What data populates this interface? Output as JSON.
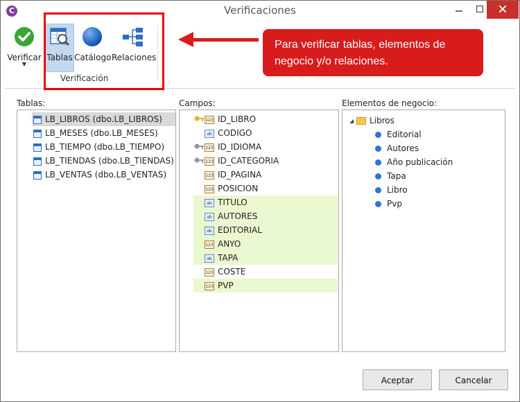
{
  "window": {
    "title": "Verificaciones",
    "app_icon": "C"
  },
  "ribbon": {
    "verificar_label": "Verificar",
    "tablas_label": "Tablas",
    "catalogo_label": "Catálogo",
    "relaciones_label": "Relaciones",
    "group_label": "Verificación",
    "dropdown_glyph": "▼"
  },
  "callout": {
    "text": "Para verificar tablas, elementos de negocio y/o relaciones."
  },
  "tablas": {
    "label": "Tablas:",
    "items": [
      "LB_LIBROS (dbo.LB_LIBROS)",
      "LB_MESES (dbo.LB_MESES)",
      "LB_TIEMPO (dbo.LB_TIEMPO)",
      "LB_TIENDAS (dbo.LB_TIENDAS)",
      "LB_VENTAS (dbo.LB_VENTAS)"
    ],
    "selected_index": 0
  },
  "campos": {
    "label": "Campos:",
    "items": [
      {
        "name": "ID_LIBRO",
        "key": "primary-key-icon",
        "type": "numeric",
        "type_glyph": "123",
        "highlight": false
      },
      {
        "name": "CODIGO",
        "key": "",
        "type": "text",
        "type_glyph": "ab",
        "highlight": false
      },
      {
        "name": "ID_IDIOMA",
        "key": "foreign-key-icon",
        "type": "numeric",
        "type_glyph": "123",
        "highlight": false
      },
      {
        "name": "ID_CATEGORIA",
        "key": "foreign-key-icon",
        "type": "numeric",
        "type_glyph": "123",
        "highlight": false
      },
      {
        "name": "ID_PAGINA",
        "key": "",
        "type": "numeric",
        "type_glyph": "123",
        "highlight": false
      },
      {
        "name": "POSICION",
        "key": "",
        "type": "numeric",
        "type_glyph": "123",
        "highlight": false
      },
      {
        "name": "TITULO",
        "key": "",
        "type": "text",
        "type_glyph": "ab",
        "highlight": true
      },
      {
        "name": "AUTORES",
        "key": "",
        "type": "text",
        "type_glyph": "ab",
        "highlight": true
      },
      {
        "name": "EDITORIAL",
        "key": "",
        "type": "text",
        "type_glyph": "ab",
        "highlight": true
      },
      {
        "name": "ANYO",
        "key": "",
        "type": "numeric",
        "type_glyph": "123",
        "highlight": true
      },
      {
        "name": "TAPA",
        "key": "",
        "type": "text",
        "type_glyph": "ab",
        "highlight": true
      },
      {
        "name": "COSTE",
        "key": "",
        "type": "numeric",
        "type_glyph": "123",
        "highlight": false
      },
      {
        "name": "PVP",
        "key": "",
        "type": "numeric",
        "type_glyph": "123",
        "highlight": true
      }
    ]
  },
  "elementos": {
    "label": "Elementos de negocio:",
    "root": "Libros",
    "expand_glyph": "◢",
    "children": [
      "Editorial",
      "Autores",
      "Año publicación",
      "Tapa",
      "Libro",
      "Pvp"
    ]
  },
  "buttons": {
    "ok": "Aceptar",
    "cancel": "Cancelar"
  },
  "colors": {
    "highlight_red": "#d81c1c",
    "field_highlight": "#e9f8cf",
    "selected_row": "#d9d9d9",
    "close_button": "#c9302c"
  }
}
